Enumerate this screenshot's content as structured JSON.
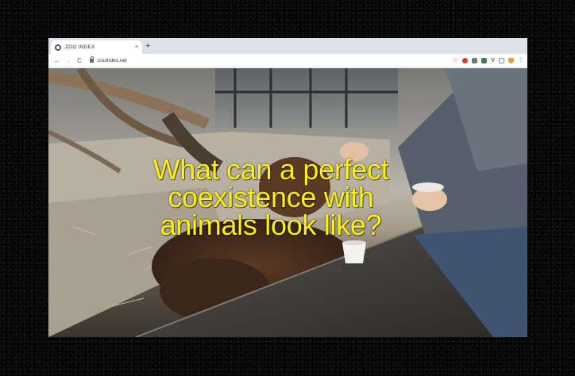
{
  "browser": {
    "tab": {
      "title": "ZOO INDEX",
      "close_glyph": "×",
      "favicon": "globe-icon"
    },
    "new_tab_glyph": "+",
    "toolbar": {
      "back_glyph": "←",
      "forward_glyph": "→",
      "reload_glyph": "C",
      "url": "zooindex.net",
      "star_glyph": "☆",
      "verge_glyph": "V",
      "menu_glyph": "⋮"
    }
  },
  "page": {
    "headline_lines": [
      "What can a perfect",
      "coexistence with",
      "animals look like?"
    ],
    "headline_color": "#fff200"
  }
}
